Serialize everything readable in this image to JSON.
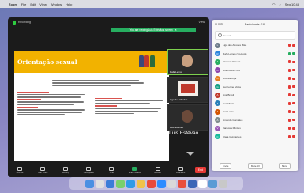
{
  "menubar": {
    "app": "Zoom",
    "items": [
      "File",
      "Edit",
      "View",
      "Window",
      "Help"
    ],
    "clock": "Seg 10:48"
  },
  "zoom": {
    "recording_label": "Recording",
    "view_label": "View",
    "banner_text": "You are viewing Luis Estêvão's screen",
    "banner_close": "×",
    "slide_title": "Orientação sexual",
    "thumbs": [
      {
        "name": "Rafa Lemos"
      },
      {
        "name": "Liga dos Afrodes"
      },
      {
        "name": "Luis Estêvão"
      }
    ],
    "speaker_name": "Luis Estêvão",
    "toolbar": [
      {
        "label": "Unmute",
        "icon": "mic-icon"
      },
      {
        "label": "Start Video",
        "icon": "video-icon"
      },
      {
        "label": "Security",
        "icon": "shield-icon"
      },
      {
        "label": "Participants",
        "icon": "participants-icon"
      },
      {
        "label": "Chat",
        "icon": "chat-icon"
      },
      {
        "label": "Share Screen",
        "icon": "share-screen-icon"
      },
      {
        "label": "Record",
        "icon": "record-icon"
      },
      {
        "label": "Reactions",
        "icon": "reactions-icon"
      }
    ],
    "end_label": "End"
  },
  "panel": {
    "title": "Participants (18)",
    "search_placeholder": "Search",
    "participants": [
      {
        "name": "Liga dos Afrodes (Me)",
        "color": "#6c7a89",
        "initial": "L"
      },
      {
        "name": "Rafa Lemos (Co-host)",
        "color": "#2e86de",
        "initial": "R"
      },
      {
        "name": "Alemaro Pereira",
        "color": "#27ae60",
        "initial": "A"
      },
      {
        "name": "Ana Pereira Grif",
        "color": "#8e44ad",
        "initial": "A"
      },
      {
        "name": "Andréa Arpa",
        "color": "#e67e22",
        "initial": "A"
      },
      {
        "name": "Guilherme Motta",
        "color": "#16a085",
        "initial": "G"
      },
      {
        "name": "Ana Brasil",
        "color": "#c0392b",
        "initial": "A"
      },
      {
        "name": "Ana Maria",
        "color": "#2980b9",
        "initial": "A"
      },
      {
        "name": "Ana Lúcia",
        "color": "#d35400",
        "initial": "A"
      },
      {
        "name": "Amanda Gonzales",
        "color": "#7f8c8d",
        "initial": "A"
      },
      {
        "name": "Vanessa Montes",
        "color": "#9b59b6",
        "initial": "V"
      },
      {
        "name": "Clara Guimarães",
        "color": "#1abc9c",
        "initial": "C"
      }
    ],
    "invite_label": "Invite",
    "mute_all_label": "Mute All",
    "more_label": "More"
  }
}
